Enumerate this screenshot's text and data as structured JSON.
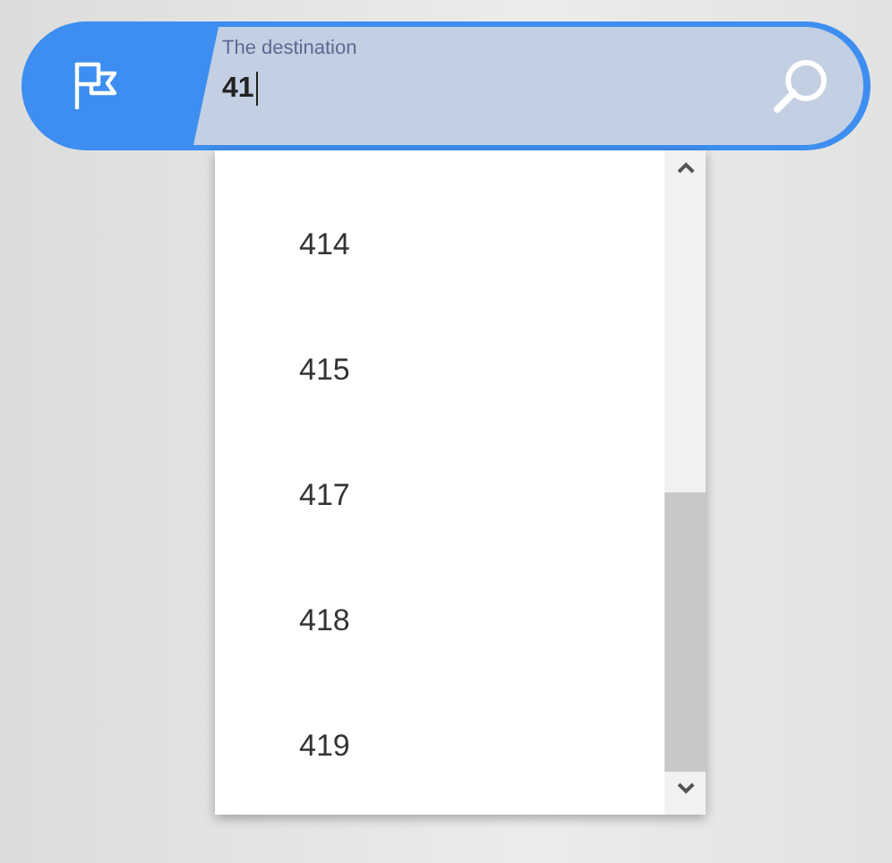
{
  "search_bar": {
    "label": "The destination",
    "value": "41"
  },
  "suggestions": [
    {
      "text": "414"
    },
    {
      "text": "415"
    },
    {
      "text": "417"
    },
    {
      "text": "418"
    },
    {
      "text": "419"
    }
  ]
}
